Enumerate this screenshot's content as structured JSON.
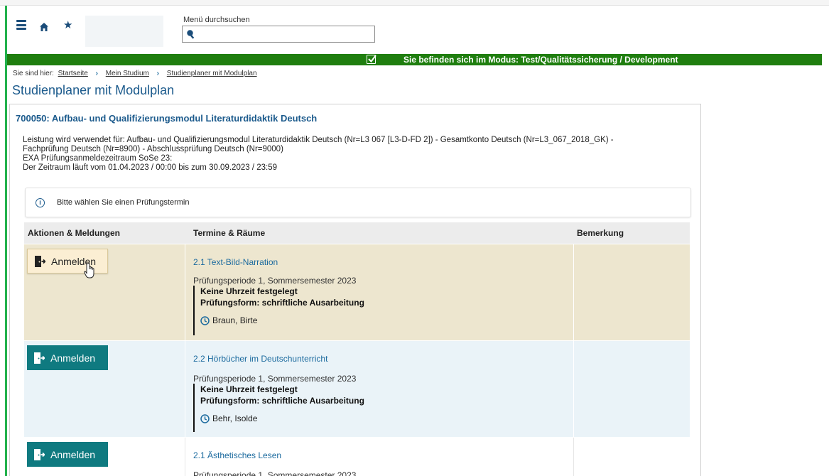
{
  "header": {
    "search_label": "Menü durchsuchen",
    "search_value": ""
  },
  "banner": {
    "text": "Sie befinden sich im Modus: Test/Qualitätssicherung / Development"
  },
  "breadcrumb": {
    "prefix": "Sie sind hier:",
    "items": [
      "Startseite",
      "Mein Studium",
      "Studienplaner mit Modulplan"
    ]
  },
  "page_title": "Studienplaner mit Modulplan",
  "module": {
    "title": "700050: Aufbau- und Qualifizierungsmodul Literaturdidaktik Deutsch",
    "info_lines": [
      "Leistung wird verwendet für: Aufbau- und Qualifizierungsmodul Literaturdidaktik Deutsch (Nr=L3 067 [L3-D-FD 2]) - Gesamtkonto Deutsch (Nr=L3_067_2018_GK) -",
      "Fachprüfung Deutsch (Nr=8900) - Abschlussprüfung Deutsch (Nr=9000)",
      "EXA Prüfungsanmeldezeitraum SoSe 23:",
      "Der Zeitraum läuft vom 01.04.2023 / 00:00 bis zum 30.09.2023 / 23:59"
    ]
  },
  "notice": "Bitte wählen Sie einen Prüfungstermin",
  "table": {
    "headers": [
      "Aktionen & Meldungen",
      "Termine & Räume",
      "Bemerkung"
    ],
    "rows": [
      {
        "button": "Anmelden",
        "course": "2.1 Text-Bild-Narration",
        "period": "Prüfungsperiode 1, Sommersemester 2023",
        "time": "Keine Uhrzeit festgelegt",
        "form": "Prüfungsform: schriftliche Ausarbeitung",
        "person": "Braun, Birte",
        "remark": ""
      },
      {
        "button": "Anmelden",
        "course": "2.2 Hörbücher im Deutschunterricht",
        "period": "Prüfungsperiode 1, Sommersemester 2023",
        "time": "Keine Uhrzeit festgelegt",
        "form": "Prüfungsform: schriftliche Ausarbeitung",
        "person": "Behr, Isolde",
        "remark": ""
      },
      {
        "button": "Anmelden",
        "course": "2.1 Ästhetisches Lesen",
        "period": "Prüfungsperiode 1, Sommersemester 2023",
        "remark": ""
      }
    ]
  },
  "colors": {
    "banner_green": "#1f7e0f",
    "frame_green": "#22b14c",
    "title_blue": "#1b5a8c",
    "link_blue": "#1b6a9e",
    "button_teal": "#0f7a80",
    "button_hover": "#fbeed3",
    "row1_bg": "#ede6cf",
    "row2_bg": "#eaf3f8",
    "row3_bg": "#ffffff"
  },
  "icons": [
    "menu-icon",
    "home-icon",
    "star-icon",
    "search-icon",
    "checkbox-icon",
    "info-icon",
    "door-exit-icon",
    "clock-icon",
    "hand-cursor-icon"
  ]
}
